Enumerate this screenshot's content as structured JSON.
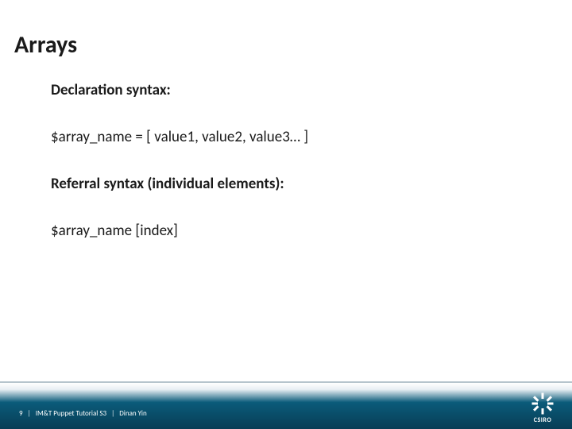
{
  "title": "Arrays",
  "content": {
    "line1_label": "Declaration syntax:",
    "line2_code": "$array_name = [ value1, value2, value3… ]",
    "line3_label": "Referral syntax (individual elements):",
    "line4_code": "$array_name [index]"
  },
  "footer": {
    "page": "9",
    "doc": "IM&T Puppet Tutorial S3",
    "author": "Dinan Yin",
    "sep": "|"
  },
  "logo": {
    "name": "CSIRO"
  }
}
